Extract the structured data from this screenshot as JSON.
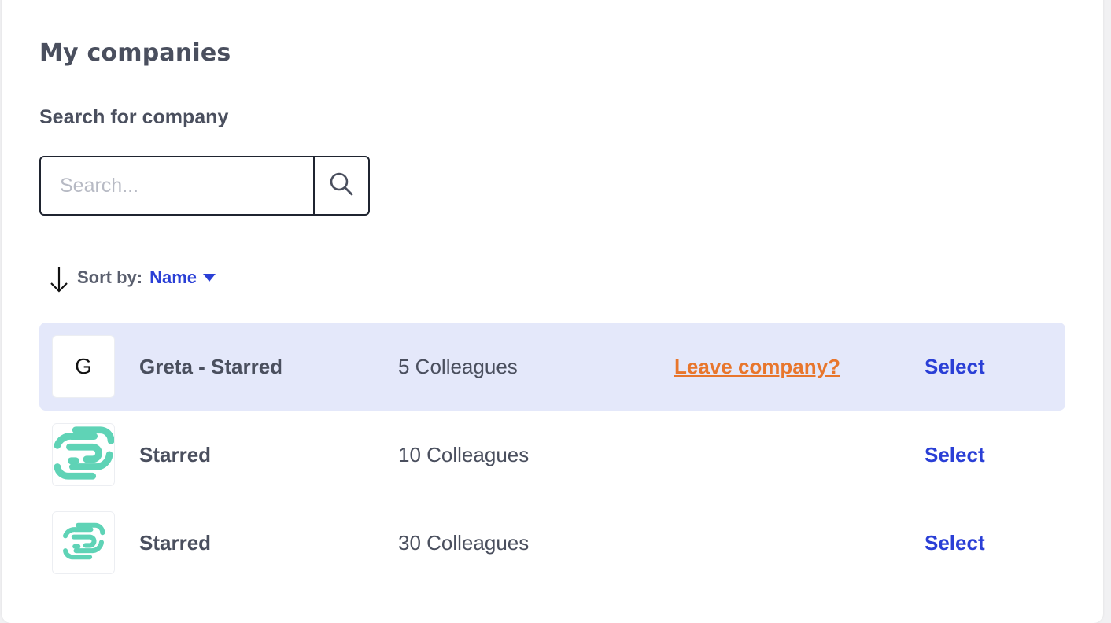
{
  "page": {
    "title": "My companies"
  },
  "search": {
    "label": "Search for company",
    "placeholder": "Search...",
    "value": ""
  },
  "sort": {
    "label": "Sort by:",
    "value": "Name",
    "direction_icon": "arrow-down-icon"
  },
  "companies": [
    {
      "logo_type": "letter",
      "logo_letter": "G",
      "name": "Greta - Starred",
      "colleagues": "5 Colleagues",
      "leave_label": "Leave company?",
      "select_label": "Select",
      "highlighted": true
    },
    {
      "logo_type": "image",
      "logo_icon": "green-swirl-logo-icon",
      "name": "Starred",
      "colleagues": "10 Colleagues",
      "select_label": "Select",
      "highlighted": false
    },
    {
      "logo_type": "image",
      "logo_icon": "green-swirl-logo-icon",
      "name": "Starred",
      "colleagues": "30 Colleagues",
      "select_label": "Select",
      "highlighted": false
    }
  ],
  "colors": {
    "accent": "#2a3fd6",
    "warning_link": "#e8762c",
    "highlight_row": "#e4e8fa",
    "logo_green": "#5fd3b6",
    "text": "#4a4f5e"
  }
}
